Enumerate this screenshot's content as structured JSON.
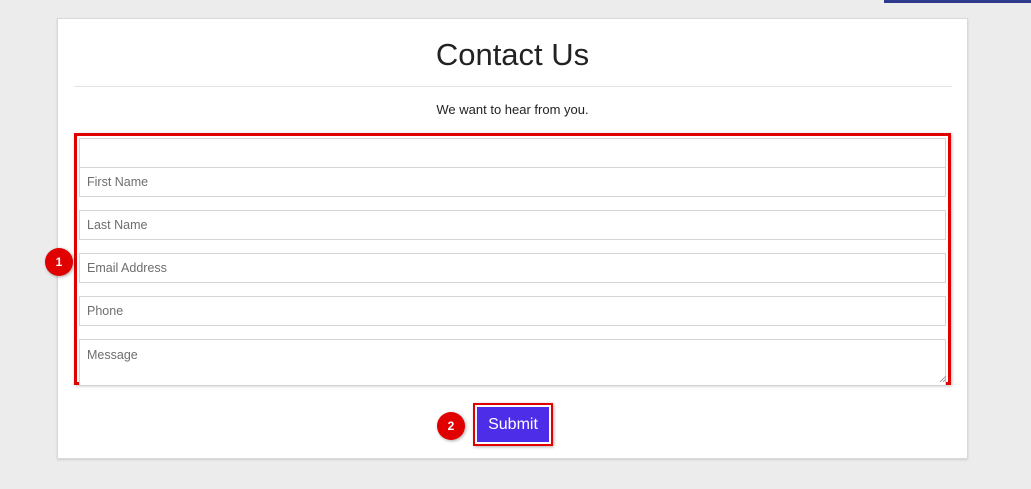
{
  "page": {
    "title": "Contact Us",
    "subtitle": "We want to hear from you."
  },
  "form": {
    "first_name_placeholder": "First Name",
    "last_name_placeholder": "Last Name",
    "email_placeholder": "Email Address",
    "phone_placeholder": "Phone",
    "message_placeholder": "Message",
    "submit_label": "Submit"
  },
  "annotations": {
    "form_marker": "1",
    "submit_marker": "2"
  },
  "colors": {
    "accent": "#4d2de8",
    "highlight": "#e00000",
    "top_bar": "#2e3a8c"
  }
}
